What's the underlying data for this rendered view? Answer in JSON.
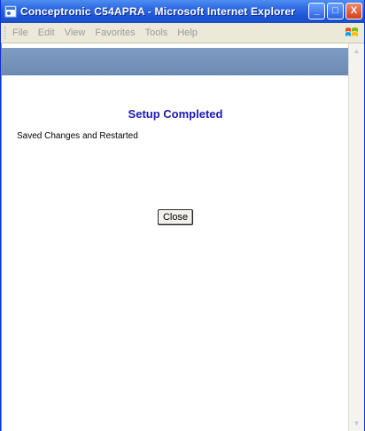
{
  "window": {
    "title": "Conceptronic C54APRA - Microsoft Internet Explorer",
    "buttons": {
      "minimize": "_",
      "maximize": "□",
      "close": "X"
    }
  },
  "menubar": {
    "items": [
      "File",
      "Edit",
      "View",
      "Favorites",
      "Tools",
      "Help"
    ]
  },
  "page": {
    "heading": "Setup Completed",
    "message": "Saved Changes and Restarted",
    "close_button": "Close"
  },
  "colors": {
    "heading": "#1b1bb5",
    "band": "#7f9cc2",
    "titlebar": "#1e56d6"
  },
  "icons": {
    "app": "ie-page-icon",
    "logo": "windows-logo-icon",
    "scroll_up": "scroll-up-arrow-icon",
    "scroll_down": "scroll-down-arrow-icon"
  }
}
